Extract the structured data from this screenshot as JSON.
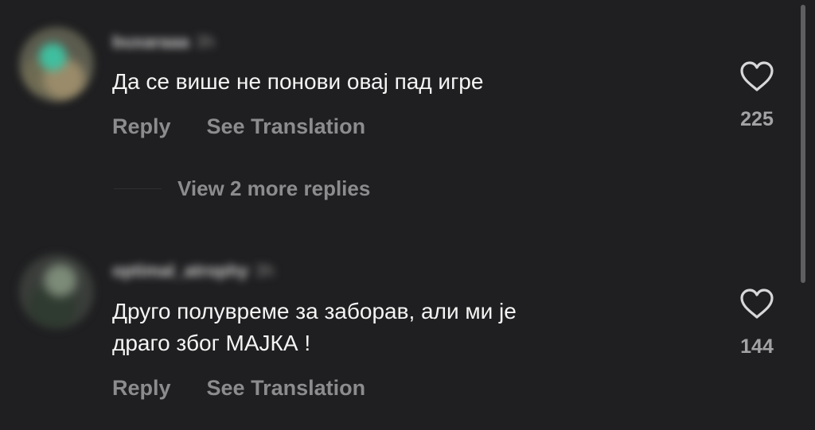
{
  "comments": [
    {
      "username": "buxaraaa",
      "time": "3h",
      "text_lines": [
        "Да се више не понови овај пад игре"
      ],
      "reply_label": "Reply",
      "translate_label": "See Translation",
      "likes": "225",
      "view_more": "View 2 more replies"
    },
    {
      "username": "optimal_atrophy",
      "time": "3h",
      "text_lines": [
        "Друго полувреме за заборав, али ми је",
        "драго због МАЈКА !"
      ],
      "reply_label": "Reply",
      "translate_label": "See Translation",
      "likes": "144"
    }
  ],
  "icons": {
    "like": "heart-outline-icon"
  },
  "colors": {
    "background": "#1f1f21",
    "text": "#f4f4f4",
    "muted": "#8c8c8e"
  }
}
